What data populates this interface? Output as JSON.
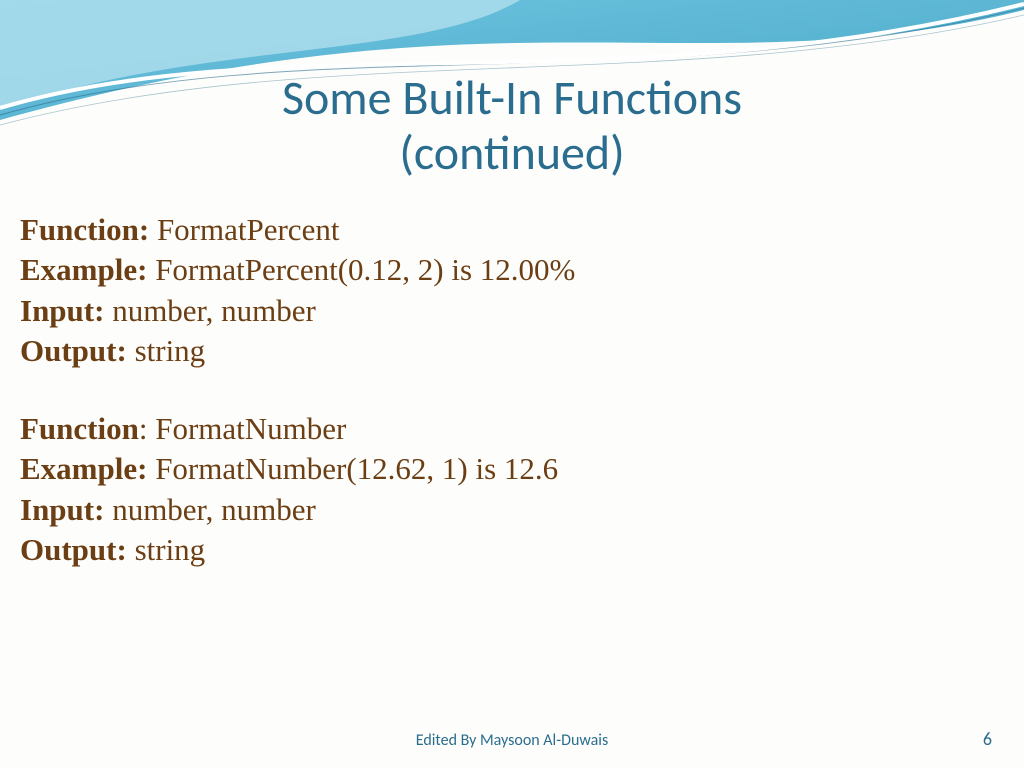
{
  "title_line1": "Some Built-In Functions",
  "title_line2": "(continued)",
  "blocks": [
    {
      "function_label": "Function:",
      "function_value": " FormatPercent",
      "example_label": "Example:",
      "example_value": " FormatPercent(0.12, 2) is 12.00%",
      "input_label": "Input:",
      "input_value": " number, number",
      "output_label": "Output:",
      "output_value": " string"
    },
    {
      "function_label": "Function",
      "function_sep": ": ",
      "function_value": "FormatNumber",
      "example_label": "Example:",
      "example_value": " FormatNumber(12.62, 1) is 12.6",
      "input_label": "Input:",
      "input_value": " number, number",
      "output_label": "Output:",
      "output_value": " string"
    }
  ],
  "footer_credit": "Edited By Maysoon Al-Duwais",
  "page_number": "6"
}
